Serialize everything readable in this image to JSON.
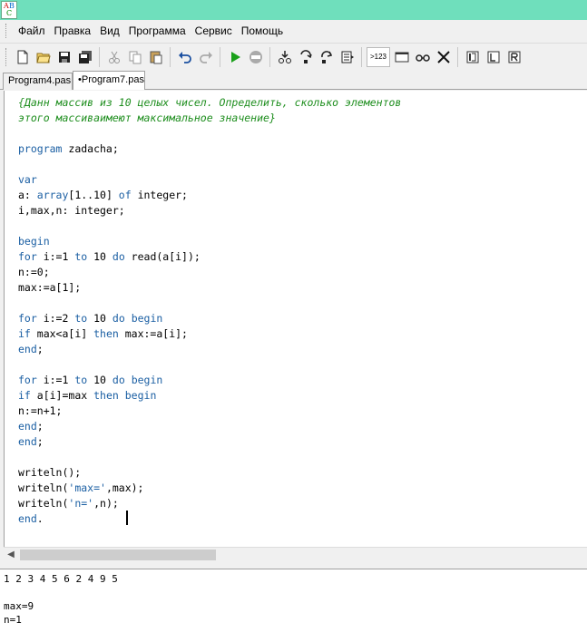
{
  "app": {
    "icon_letters": [
      "A",
      "B",
      "C"
    ]
  },
  "menu": [
    "Файл",
    "Правка",
    "Вид",
    "Программа",
    "Сервис",
    "Помощь"
  ],
  "toolbar": {
    "icons": [
      "new-file-icon",
      "open-folder-icon",
      "save-icon",
      "save-all-icon",
      "cut-icon",
      "copy-icon",
      "paste-icon",
      "undo-icon",
      "redo-icon",
      "run-icon",
      "stop-icon",
      "step-into-icon",
      "step-over-icon",
      "step-out-icon",
      "run-to-cursor-icon",
      "console-icon",
      "watch-icon",
      "close-icon",
      "debug-icon",
      "layout-icon",
      "run-icon-2"
    ],
    "counter_label": ">123"
  },
  "tabs": [
    {
      "label": "Program4.pas"
    },
    {
      "label": "•Program7.pas"
    }
  ],
  "code": [
    [
      [
        "cm",
        "{Данн массив из 10 целых чисел. Определить, сколько элементов"
      ]
    ],
    [
      [
        "cm",
        "этого массиваимеют максимальное значение}"
      ]
    ],
    [],
    [
      [
        "kw",
        "program"
      ],
      [
        "id",
        " zadacha;"
      ]
    ],
    [],
    [
      [
        "kw",
        "var"
      ]
    ],
    [
      [
        "id",
        "a: "
      ],
      [
        "kw",
        "array"
      ],
      [
        "id",
        "[1..10] "
      ],
      [
        "kw",
        "of"
      ],
      [
        "id",
        " integer;"
      ]
    ],
    [
      [
        "id",
        "i,max,n: integer;"
      ]
    ],
    [],
    [
      [
        "kw",
        "begin"
      ]
    ],
    [
      [
        "kw",
        "for"
      ],
      [
        "id",
        " i:=1 "
      ],
      [
        "kw",
        "to"
      ],
      [
        "id",
        " 10 "
      ],
      [
        "kw",
        "do"
      ],
      [
        "id",
        " read(a[i]);"
      ]
    ],
    [
      [
        "id",
        "n:=0;"
      ]
    ],
    [
      [
        "id",
        "max:=a[1];"
      ]
    ],
    [],
    [
      [
        "kw",
        "for"
      ],
      [
        "id",
        " i:=2 "
      ],
      [
        "kw",
        "to"
      ],
      [
        "id",
        " 10 "
      ],
      [
        "kw",
        "do"
      ],
      [
        "id",
        " "
      ],
      [
        "kw",
        "begin"
      ]
    ],
    [
      [
        "kw",
        "if"
      ],
      [
        "id",
        " max<a[i] "
      ],
      [
        "kw",
        "then"
      ],
      [
        "id",
        " max:=a[i];"
      ]
    ],
    [
      [
        "kw",
        "end"
      ],
      [
        "id",
        ";"
      ]
    ],
    [],
    [
      [
        "kw",
        "for"
      ],
      [
        "id",
        " i:=1 "
      ],
      [
        "kw",
        "to"
      ],
      [
        "id",
        " 10 "
      ],
      [
        "kw",
        "do"
      ],
      [
        "id",
        " "
      ],
      [
        "kw",
        "begin"
      ]
    ],
    [
      [
        "kw",
        "if"
      ],
      [
        "id",
        " a[i]=max "
      ],
      [
        "kw",
        "then"
      ],
      [
        "id",
        " "
      ],
      [
        "kw",
        "begin"
      ]
    ],
    [
      [
        "id",
        "n:=n+1;"
      ]
    ],
    [
      [
        "kw",
        "end"
      ],
      [
        "id",
        ";"
      ]
    ],
    [
      [
        "kw",
        "end"
      ],
      [
        "id",
        ";"
      ]
    ],
    [],
    [
      [
        "id",
        "writeln();"
      ]
    ],
    [
      [
        "id",
        "writeln("
      ],
      [
        "st",
        "'max='"
      ],
      [
        "id",
        ",max);"
      ]
    ],
    [
      [
        "id",
        "writeln("
      ],
      [
        "st",
        "'n='"
      ],
      [
        "id",
        ",n);"
      ]
    ],
    [
      [
        "kw",
        "end"
      ],
      [
        "id",
        "."
      ]
    ]
  ],
  "output": [
    "1 2 3 4 5 6 2 4 9 5",
    "",
    "max=9",
    "n=1"
  ],
  "colors": {
    "titlebar": "#6fdfbc",
    "keyword": "#1b5fa3",
    "comment": "#1e8e1e"
  }
}
